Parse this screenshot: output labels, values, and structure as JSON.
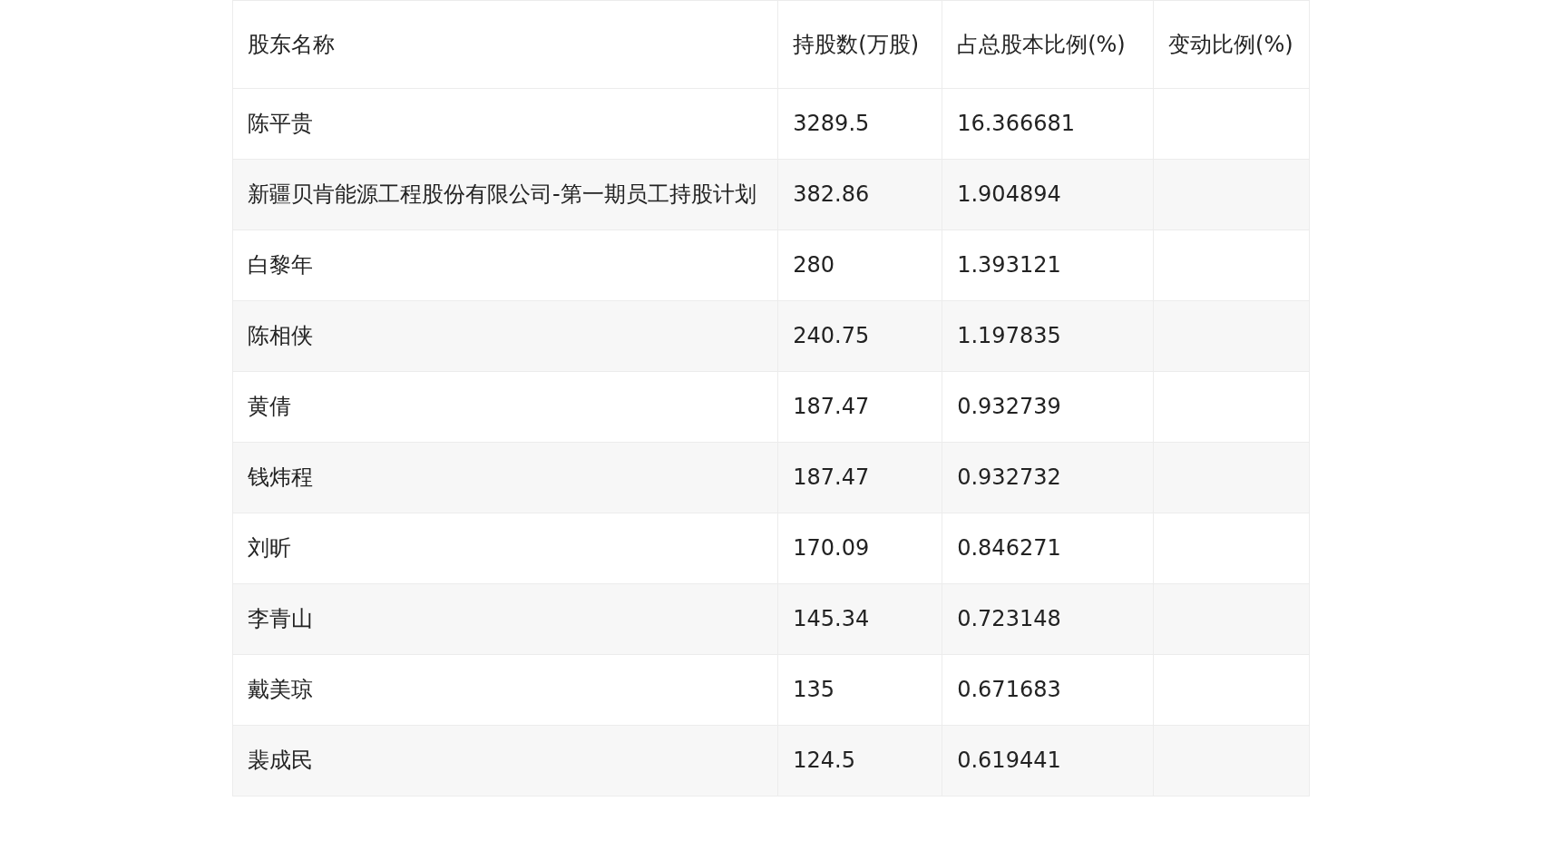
{
  "table": {
    "columns": [
      "股东名称",
      "持股数(万股)",
      "占总股本比例(%)",
      "变动比例(%)"
    ],
    "rows": [
      {
        "name": "陈平贵",
        "shares": "3289.5",
        "ratio": "16.366681"
      },
      {
        "name": "新疆贝肯能源工程股份有限公司-第一期员工持股计划",
        "shares": "382.86",
        "ratio": "1.904894"
      },
      {
        "name": "白黎年",
        "shares": "280",
        "ratio": "1.393121"
      },
      {
        "name": "陈相侠",
        "shares": "240.75",
        "ratio": "1.197835"
      },
      {
        "name": "黄倩",
        "shares": "187.47",
        "ratio": "0.932739"
      },
      {
        "name": "钱炜程",
        "shares": "187.47",
        "ratio": "0.932732"
      },
      {
        "name": "刘昕",
        "shares": "170.09",
        "ratio": "0.846271"
      },
      {
        "name": "李青山",
        "shares": "145.34",
        "ratio": "0.723148"
      },
      {
        "name": "戴美琼",
        "shares": "135",
        "ratio": "0.671683"
      },
      {
        "name": "裴成民",
        "shares": "124.5",
        "ratio": "0.619441"
      }
    ]
  }
}
